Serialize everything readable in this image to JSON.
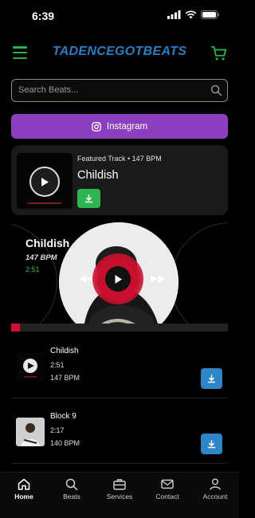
{
  "status": {
    "time": "6:39"
  },
  "header": {
    "logo": "TADENCEGOTBEATS"
  },
  "search": {
    "placeholder": "Search Beats..."
  },
  "instagram": {
    "label": "Instagram"
  },
  "featured": {
    "meta": "Featured Track • 147 BPM",
    "title": "Childish"
  },
  "player": {
    "title": "Childish",
    "bpm": "147 BPM",
    "time": "2:51",
    "progress_fraction": 0.04
  },
  "tracks": [
    {
      "title": "Childish",
      "length": "2:51",
      "bpm": "147 BPM"
    },
    {
      "title": "Block 9",
      "length": "2:17",
      "bpm": "140 BPM"
    }
  ],
  "nav": [
    {
      "label": "Home",
      "icon": "home-icon",
      "active": true
    },
    {
      "label": "Beats",
      "icon": "search-icon"
    },
    {
      "label": "Services",
      "icon": "briefcase-icon"
    },
    {
      "label": "Contact",
      "icon": "envelope-icon"
    },
    {
      "label": "Account",
      "icon": "person-icon"
    }
  ],
  "colors": {
    "accent_green": "#2fb54f",
    "logo_blue": "#2d7cc2",
    "instagram_purple": "#8b3fbf",
    "player_red": "#c8102e",
    "download_blue": "#2d86c9"
  }
}
